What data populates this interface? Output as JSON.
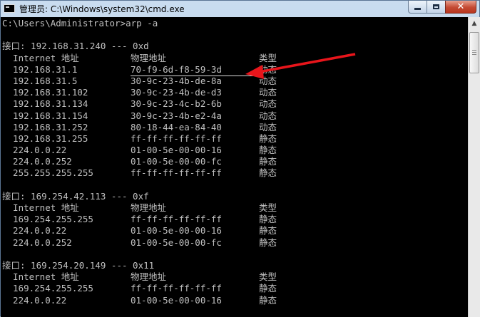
{
  "window": {
    "title": "管理员: C:\\Windows\\system32\\cmd.exe",
    "controls": {
      "close": "✕"
    }
  },
  "console": {
    "lines": [
      {
        "text": "C:\\Users\\Administrator>arp -a"
      },
      {
        "text": ""
      },
      {
        "text": "接口: 192.168.31.240 --- 0xd"
      },
      {
        "c1": "  Internet 地址",
        "c2": "物理地址",
        "c3": "类型"
      },
      {
        "c1": "  192.168.31.1",
        "c2": "70-f9-6d-f8-59-3d",
        "c3": "动态",
        "highlight": true
      },
      {
        "c1": "  192.168.31.5",
        "c2": "30-9c-23-4b-de-8a",
        "c3": "动态"
      },
      {
        "c1": "  192.168.31.102",
        "c2": "30-9c-23-4b-de-d3",
        "c3": "动态"
      },
      {
        "c1": "  192.168.31.134",
        "c2": "30-9c-23-4c-b2-6b",
        "c3": "动态"
      },
      {
        "c1": "  192.168.31.154",
        "c2": "30-9c-23-4b-e2-4a",
        "c3": "动态"
      },
      {
        "c1": "  192.168.31.252",
        "c2": "80-18-44-ea-84-40",
        "c3": "动态"
      },
      {
        "c1": "  192.168.31.255",
        "c2": "ff-ff-ff-ff-ff-ff",
        "c3": "静态"
      },
      {
        "c1": "  224.0.0.22",
        "c2": "01-00-5e-00-00-16",
        "c3": "静态"
      },
      {
        "c1": "  224.0.0.252",
        "c2": "01-00-5e-00-00-fc",
        "c3": "静态"
      },
      {
        "c1": "  255.255.255.255",
        "c2": "ff-ff-ff-ff-ff-ff",
        "c3": "静态"
      },
      {
        "text": ""
      },
      {
        "text": "接口: 169.254.42.113 --- 0xf"
      },
      {
        "c1": "  Internet 地址",
        "c2": "物理地址",
        "c3": "类型"
      },
      {
        "c1": "  169.254.255.255",
        "c2": "ff-ff-ff-ff-ff-ff",
        "c3": "静态"
      },
      {
        "c1": "  224.0.0.22",
        "c2": "01-00-5e-00-00-16",
        "c3": "静态"
      },
      {
        "c1": "  224.0.0.252",
        "c2": "01-00-5e-00-00-fc",
        "c3": "静态"
      },
      {
        "text": ""
      },
      {
        "text": "接口: 169.254.20.149 --- 0x11"
      },
      {
        "c1": "  Internet 地址",
        "c2": "物理地址",
        "c3": "类型"
      },
      {
        "c1": "  169.254.255.255",
        "c2": "ff-ff-ff-ff-ff-ff",
        "c3": "静态"
      },
      {
        "c1": "  224.0.0.22",
        "c2": "01-00-5e-00-00-16",
        "c3": "静态"
      }
    ]
  },
  "annotation": {
    "arrow_color": "#e8151b"
  },
  "colors": {
    "console_bg": "#000000",
    "console_fg": "#c0c0c0"
  },
  "icons": {
    "app": "cmd-icon",
    "min": "minimize-icon",
    "max": "maximize-icon",
    "close": "close-icon",
    "scroll_up": "scroll-up-arrow-icon"
  }
}
